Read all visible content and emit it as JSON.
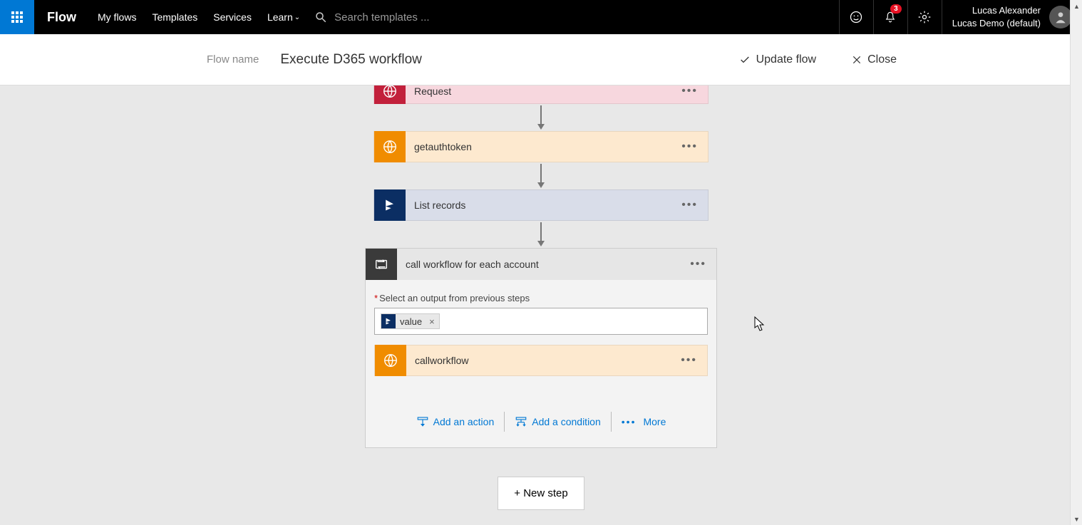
{
  "header": {
    "brand": "Flow",
    "nav": {
      "my_flows": "My flows",
      "templates": "Templates",
      "services": "Services",
      "learn": "Learn"
    },
    "search_placeholder": "Search templates ...",
    "notifications_count": "3",
    "user_name": "Lucas Alexander",
    "tenant": "Lucas Demo (default)"
  },
  "subheader": {
    "label": "Flow name",
    "value": "Execute D365 workflow",
    "update": "Update flow",
    "close": "Close"
  },
  "steps": {
    "request": "Request",
    "getauthtoken": "getauthtoken",
    "list_records": "List records"
  },
  "foreach": {
    "title": "call workflow for each account",
    "output_label": "Select an output from previous steps",
    "token": "value",
    "inner_step": "callworkflow",
    "add_action": "Add an action",
    "add_condition": "Add a condition",
    "more": "More"
  },
  "new_step": "+ New step"
}
